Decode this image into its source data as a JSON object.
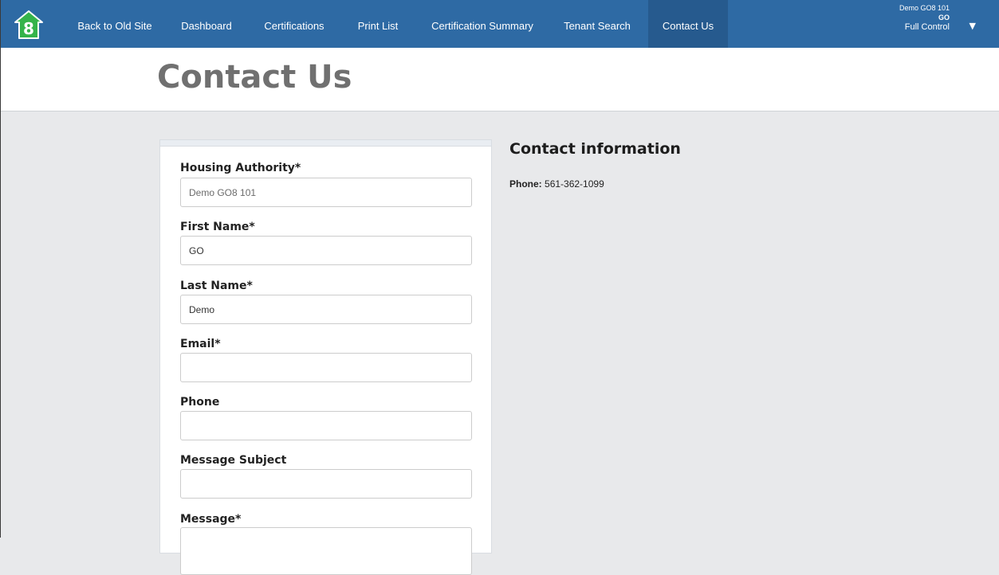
{
  "nav": {
    "logo_text": "8",
    "items": [
      {
        "label": "Back to Old Site"
      },
      {
        "label": "Dashboard"
      },
      {
        "label": "Certifications"
      },
      {
        "label": "Print List"
      },
      {
        "label": "Certification Summary"
      },
      {
        "label": "Tenant Search"
      },
      {
        "label": "Contact Us",
        "active": true
      }
    ],
    "user": {
      "organization": "Demo GO8 101",
      "name": "GO",
      "role": "Full Control",
      "caret": "▼"
    }
  },
  "page": {
    "title": "Contact Us"
  },
  "form": {
    "fields": [
      {
        "label": "Housing Authority*",
        "value": "Demo GO8 101"
      },
      {
        "label": "First Name*",
        "value": "GO"
      },
      {
        "label": "Last Name*",
        "value": "Demo"
      },
      {
        "label": "Email*",
        "value": ""
      },
      {
        "label": "Phone",
        "value": ""
      },
      {
        "label": "Message Subject",
        "value": ""
      },
      {
        "label": "Message*",
        "value": ""
      }
    ]
  },
  "contact": {
    "heading": "Contact information",
    "phone_label": "Phone:",
    "phone_value": "561-362-1099"
  },
  "colors": {
    "nav_bg": "#2e6aa4",
    "nav_active": "#265a8e",
    "logo_green": "#35b34a",
    "page_bg": "#e8e9eb"
  },
  "icons": {
    "logo": "house-8-icon",
    "user_menu": "caret-down-icon"
  }
}
